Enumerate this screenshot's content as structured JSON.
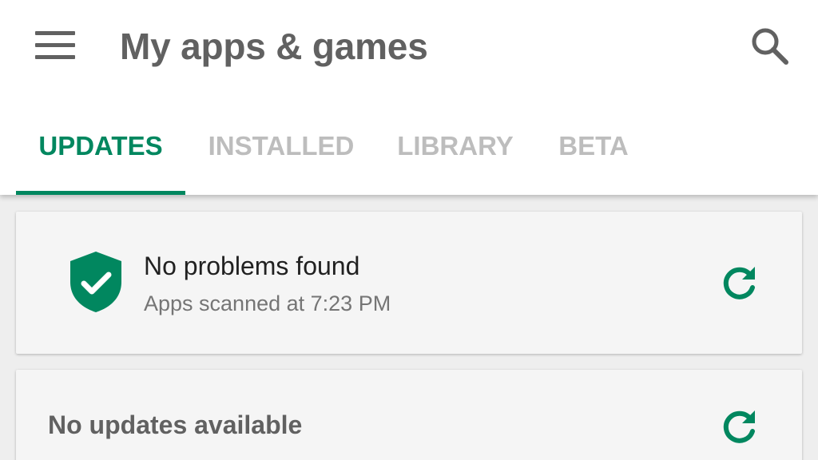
{
  "header": {
    "title": "My apps & games"
  },
  "tabs": [
    {
      "label": "UPDATES",
      "active": true
    },
    {
      "label": "INSTALLED",
      "active": false
    },
    {
      "label": "LIBRARY",
      "active": false
    },
    {
      "label": "BETA",
      "active": false
    }
  ],
  "scan_card": {
    "title": "No problems found",
    "subtitle": "Apps scanned at 7:23 PM"
  },
  "updates_card": {
    "title": "No updates available"
  },
  "colors": {
    "accent": "#01875f",
    "icon_grey": "#616161",
    "tab_inactive": "#bdbdbd"
  },
  "icons": {
    "menu": "menu-icon",
    "search": "search-icon",
    "shield": "shield-check-icon",
    "refresh": "refresh-icon"
  }
}
